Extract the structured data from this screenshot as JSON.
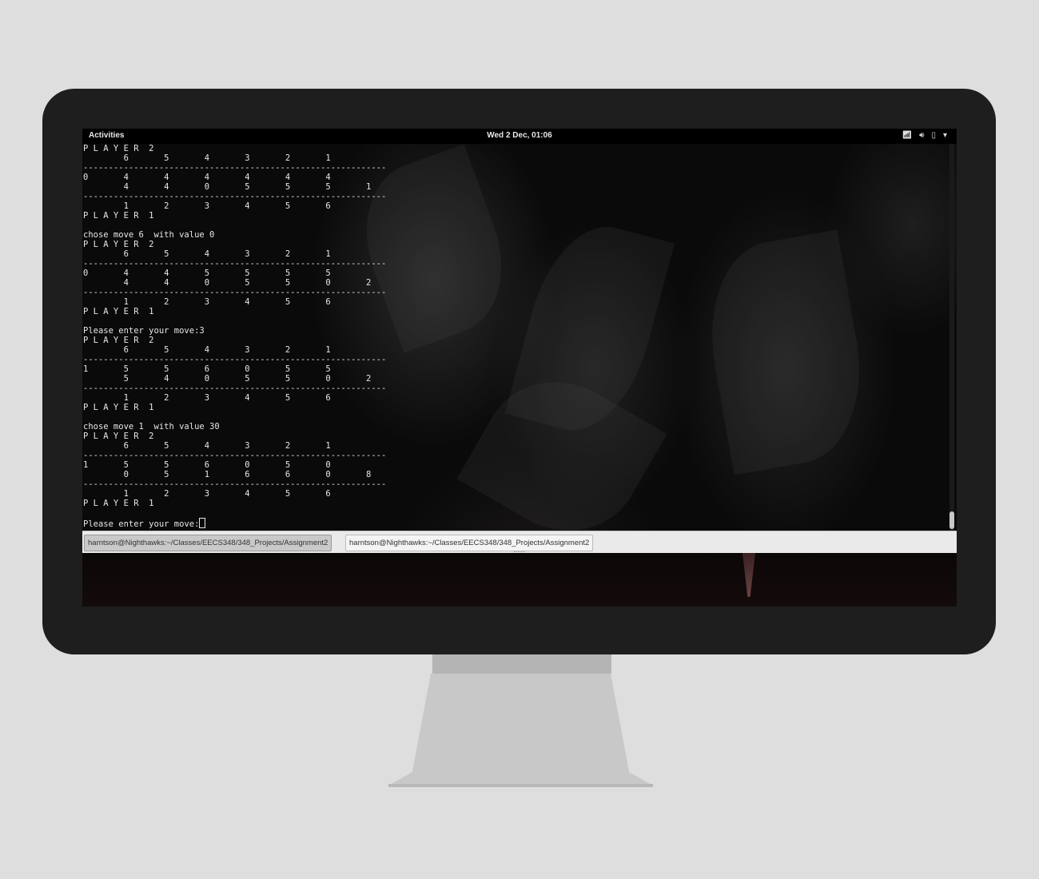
{
  "topbar": {
    "activities": "Activities",
    "clock": "Wed  2 Dec, 01:06",
    "tray_icons": [
      "wifi-icon",
      "volume-icon",
      "battery-icon",
      "dropdown-arrow-icon"
    ]
  },
  "terminal": {
    "lines": [
      "P L A Y E R  2",
      "        6       5       4       3       2       1",
      "------------------------------------------------------------",
      "0       4       4       4       4       4       4",
      "        4       4       0       5       5       5       1",
      "------------------------------------------------------------",
      "        1       2       3       4       5       6",
      "P L A Y E R  1",
      "",
      "chose move 6  with value 0",
      "P L A Y E R  2",
      "        6       5       4       3       2       1",
      "------------------------------------------------------------",
      "0       4       4       5       5       5       5",
      "        4       4       0       5       5       0       2",
      "------------------------------------------------------------",
      "        1       2       3       4       5       6",
      "P L A Y E R  1",
      "",
      "Please enter your move:3",
      "P L A Y E R  2",
      "        6       5       4       3       2       1",
      "------------------------------------------------------------",
      "1       5       5       6       0       5       5",
      "        5       4       0       5       5       0       2",
      "------------------------------------------------------------",
      "        1       2       3       4       5       6",
      "P L A Y E R  1",
      "",
      "chose move 1  with value 30",
      "P L A Y E R  2",
      "        6       5       4       3       2       1",
      "------------------------------------------------------------",
      "1       5       5       6       0       5       0",
      "        0       5       1       6       6       0       8",
      "------------------------------------------------------------",
      "        1       2       3       4       5       6",
      "P L A Y E R  1",
      ""
    ],
    "prompt": "Please enter your move:"
  },
  "taskbar": {
    "tasks": [
      {
        "label": "harntson@Nighthawks:~/Classes/EECS348/348_Projects/Assignment2",
        "active": true
      },
      {
        "label": "harntson@Nighthawks:~/Classes/EECS348/348_Projects/Assignment2",
        "active": false
      }
    ]
  }
}
